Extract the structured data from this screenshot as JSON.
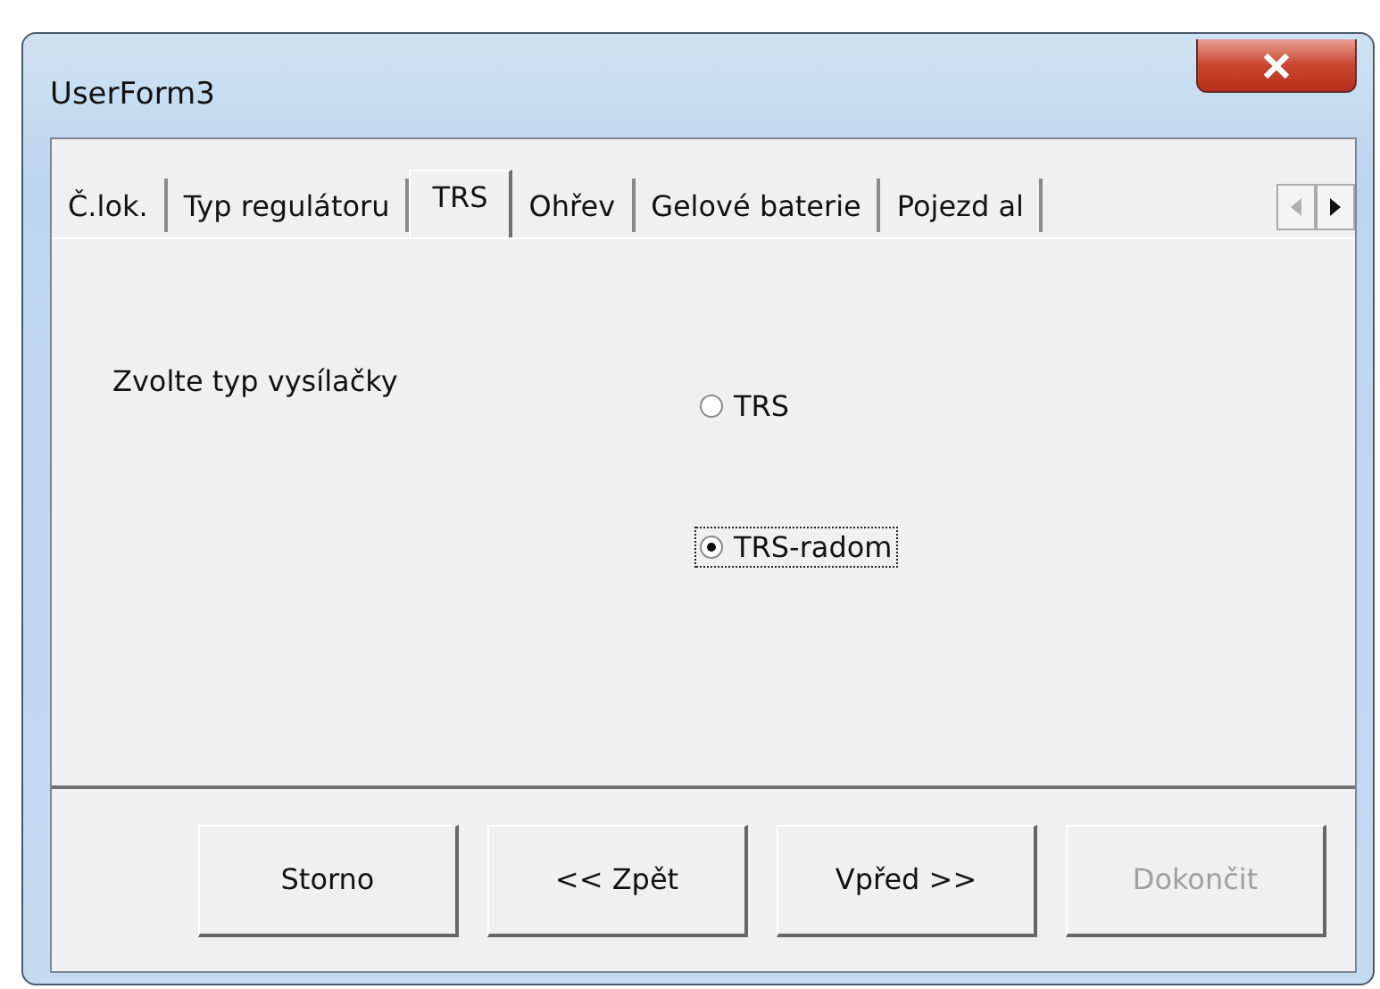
{
  "window": {
    "title": "UserForm3"
  },
  "tabs": [
    {
      "label": "Č.lok.",
      "selected": false
    },
    {
      "label": "Typ regulátoru",
      "selected": false
    },
    {
      "label": "TRS",
      "selected": true
    },
    {
      "label": "Ohřev",
      "selected": false
    },
    {
      "label": "Gelové baterie",
      "selected": false
    },
    {
      "label": "Pojezd al",
      "selected": false
    }
  ],
  "prompt": "Zvolte typ vysílačky",
  "options": [
    {
      "label": "TRS",
      "selected": false
    },
    {
      "label": "TRS-radom",
      "selected": true
    }
  ],
  "buttons": [
    {
      "label": "Storno",
      "disabled": false
    },
    {
      "label": "<< Zpět",
      "disabled": false
    },
    {
      "label": "Vpřed >>",
      "disabled": false
    },
    {
      "label": "Dokončit",
      "disabled": true
    }
  ]
}
